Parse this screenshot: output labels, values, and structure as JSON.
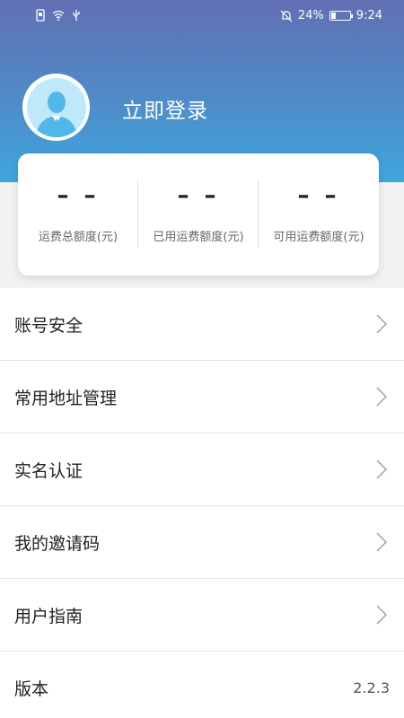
{
  "status_bar": {
    "battery_percent": "24%",
    "time": "9:24",
    "battery_level": 0.24,
    "icons_left": [
      "sim-icon",
      "wifi-icon",
      "usb-icon"
    ],
    "icons_right": [
      "bell-off-icon",
      "battery-icon"
    ]
  },
  "profile": {
    "login_text": "立即登录"
  },
  "stats": [
    {
      "value": "– –",
      "label": "运费总额度(元)"
    },
    {
      "value": "– –",
      "label": "已用运费额度(元)"
    },
    {
      "value": "– –",
      "label": "可用运费额度(元)"
    }
  ],
  "menu": {
    "items": [
      {
        "label": "账号安全"
      },
      {
        "label": "常用地址管理"
      },
      {
        "label": "实名认证"
      },
      {
        "label": "我的邀请码"
      },
      {
        "label": "用户指南"
      }
    ],
    "version": {
      "label": "版本",
      "value": "2.2.3"
    }
  },
  "colors": {
    "header_top": "#6170b3",
    "header_bottom": "#3fa6de",
    "avatar_bg": "#bfe9fb",
    "avatar_figure": "#4fb8e8"
  }
}
